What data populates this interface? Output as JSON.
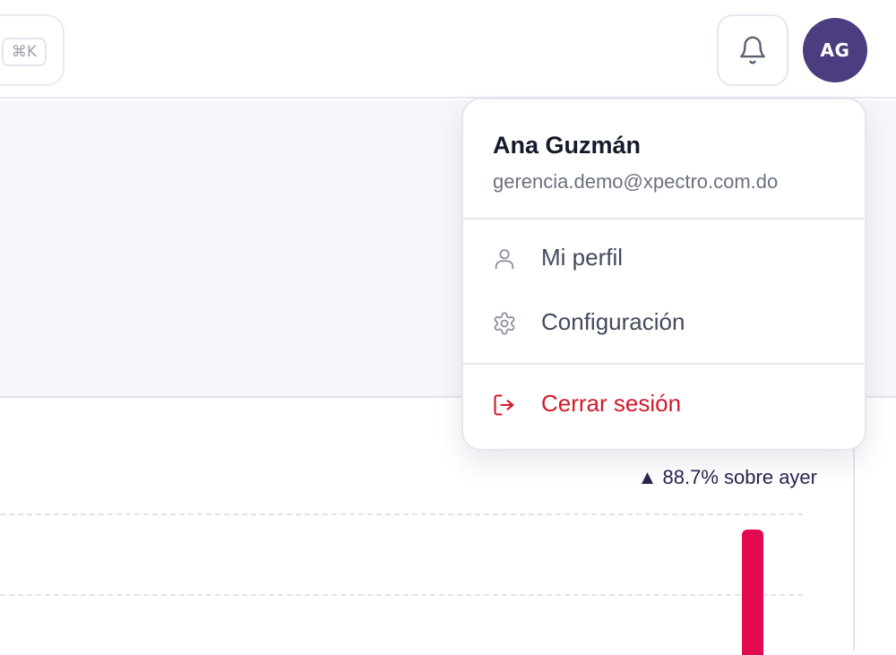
{
  "header": {
    "search_shortcut": "⌘K",
    "notifications_icon": "bell-icon",
    "avatar_initials": "AG"
  },
  "user_menu": {
    "name": "Ana Guzmán",
    "email": "gerencia.demo@xpectro.com.do",
    "items": [
      {
        "label": "Mi perfil",
        "icon": "user-icon"
      },
      {
        "label": "Configuración",
        "icon": "gear-icon"
      }
    ],
    "logout": {
      "label": "Cerrar sesión",
      "icon": "logout-icon"
    }
  },
  "stats": {
    "trend_text": "▲ 88.7% sobre ayer"
  },
  "colors": {
    "avatar_bg": "#4b3d80",
    "bar": "#e3094f",
    "danger": "#d01a2a"
  }
}
